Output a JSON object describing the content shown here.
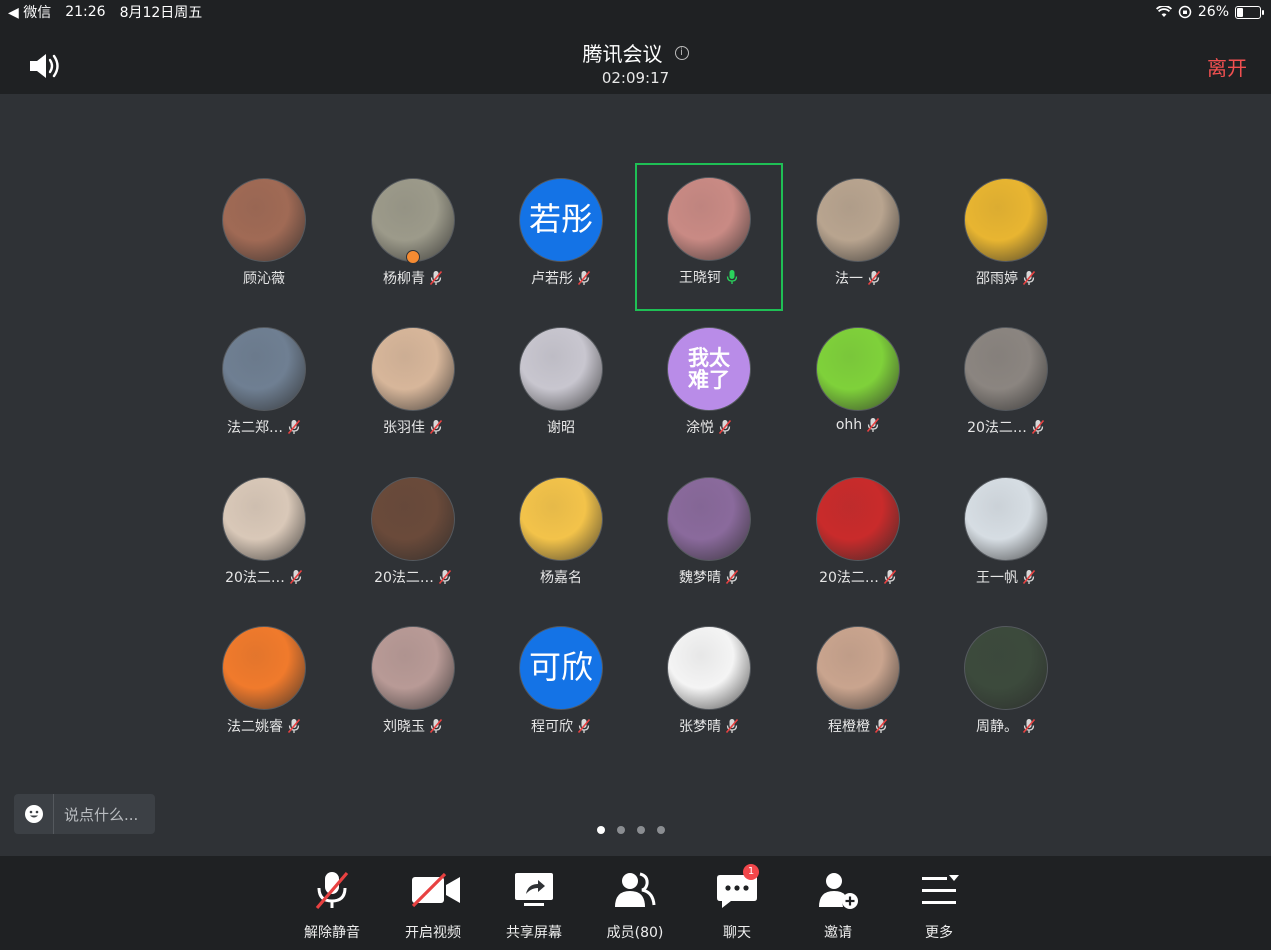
{
  "status_bar": {
    "back_app": "◀ 微信",
    "time": "21:26",
    "date": "8月12日周五",
    "battery": "26%",
    "battery_level": 0.26
  },
  "header": {
    "title": "腾讯会议",
    "info_icon": "info-icon",
    "duration": "02:09:17",
    "leave_label": "离开"
  },
  "participants": [
    {
      "name": "顾沁薇",
      "muted": false,
      "avatar_text": "",
      "avatar_color": "#a06a55"
    },
    {
      "name": "杨柳青",
      "muted": true,
      "avatar_text": "",
      "avatar_color": "#9c9a8a"
    },
    {
      "name": "卢若彤",
      "muted": true,
      "avatar_text": "若彤",
      "avatar_color": "#1473e6"
    },
    {
      "name": "王晓钶",
      "muted": false,
      "speaking": true,
      "avatar_text": "",
      "avatar_color": "#c98a84"
    },
    {
      "name": "法一",
      "muted": true,
      "avatar_text": "",
      "avatar_color": "#b8a48f"
    },
    {
      "name": "邵雨婷",
      "muted": true,
      "avatar_text": "",
      "avatar_color": "#e8b531"
    },
    {
      "name": "法二郑…",
      "muted": true,
      "avatar_text": "",
      "avatar_color": "#6f7f92"
    },
    {
      "name": "张羽佳",
      "muted": true,
      "avatar_text": "",
      "avatar_color": "#d7b69a"
    },
    {
      "name": "谢昭",
      "muted": false,
      "avatar_text": "",
      "avatar_color": "#c8c6cf"
    },
    {
      "name": "涂悦",
      "muted": true,
      "avatar_text": "我太\n难了",
      "avatar_color": "#b98ce8"
    },
    {
      "name": "ohh",
      "muted": true,
      "avatar_text": "",
      "avatar_color": "#7fd13a"
    },
    {
      "name": "20法二…",
      "muted": true,
      "avatar_text": "",
      "avatar_color": "#8b8580"
    },
    {
      "name": "20法二…",
      "muted": true,
      "avatar_text": "",
      "avatar_color": "#d9c8b8"
    },
    {
      "name": "20法二…",
      "muted": true,
      "avatar_text": "",
      "avatar_color": "#6a4a3a"
    },
    {
      "name": "杨嘉名",
      "muted": false,
      "avatar_text": "",
      "avatar_color": "#f3c34a"
    },
    {
      "name": "魏梦晴",
      "muted": true,
      "avatar_text": "",
      "avatar_color": "#8a6a9c"
    },
    {
      "name": "20法二…",
      "muted": true,
      "avatar_text": "",
      "avatar_color": "#c92b2b"
    },
    {
      "name": "王一帆",
      "muted": true,
      "avatar_text": "",
      "avatar_color": "#d6dde3"
    },
    {
      "name": "法二姚睿",
      "muted": true,
      "avatar_text": "",
      "avatar_color": "#f07a2c"
    },
    {
      "name": "刘晓玉",
      "muted": true,
      "avatar_text": "",
      "avatar_color": "#b89a96"
    },
    {
      "name": "程可欣",
      "muted": true,
      "avatar_text": "可欣",
      "avatar_color": "#1473e6"
    },
    {
      "name": "张梦晴",
      "muted": true,
      "avatar_text": "",
      "avatar_color": "#f4f4f4"
    },
    {
      "name": "程橙橙",
      "muted": true,
      "avatar_text": "",
      "avatar_color": "#c9a48e"
    },
    {
      "name": "周静。",
      "muted": true,
      "avatar_text": "",
      "avatar_color": "#3c4a3c"
    }
  ],
  "chat_input": {
    "placeholder": "说点什么..."
  },
  "pagination": {
    "pages": 4,
    "current": 1
  },
  "toolbar": {
    "items": [
      {
        "label": "解除静音",
        "icon": "mic-muted-icon"
      },
      {
        "label": "开启视频",
        "icon": "video-off-icon"
      },
      {
        "label": "共享屏幕",
        "icon": "share-screen-icon"
      },
      {
        "label": "成员(80)",
        "icon": "members-icon"
      },
      {
        "label": "聊天",
        "icon": "chat-icon",
        "badge": "1"
      },
      {
        "label": "邀请",
        "icon": "invite-icon"
      },
      {
        "label": "更多",
        "icon": "more-icon"
      }
    ]
  },
  "colors": {
    "background": "#2f3236",
    "bar": "#1f2123",
    "accent_speaking": "#1fbf55",
    "leave": "#f05050",
    "muted_red": "#e84141"
  }
}
